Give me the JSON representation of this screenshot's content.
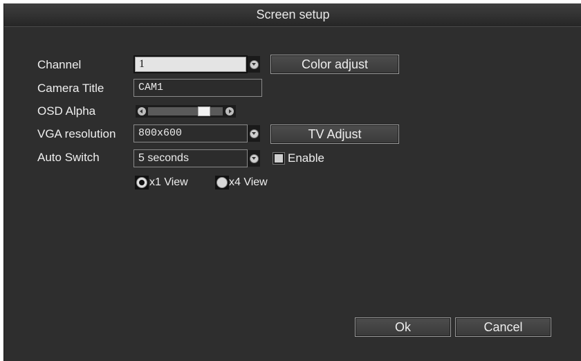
{
  "window": {
    "title": "Screen setup"
  },
  "form": {
    "channel": {
      "label": "Channel",
      "value": "1"
    },
    "camera_title": {
      "label": "Camera Title",
      "value": "CAM1"
    },
    "osd_alpha": {
      "label": "OSD Alpha",
      "level_fraction": 0.8
    },
    "vga_resolution": {
      "label": "VGA resolution",
      "value": "800x600"
    },
    "auto_switch": {
      "label": "Auto Switch",
      "value": "5 seconds",
      "enable_label": "Enable",
      "enabled": false
    },
    "view_mode": {
      "options": [
        {
          "label": "x1 View",
          "selected": true
        },
        {
          "label": "x4 View",
          "selected": false
        }
      ]
    }
  },
  "buttons": {
    "color_adjust": "Color adjust",
    "tv_adjust": "TV Adjust",
    "ok": "Ok",
    "cancel": "Cancel"
  },
  "icons": {
    "dropdown": "chevron-down-icon",
    "slider_left": "arrow-left-icon",
    "slider_right": "arrow-right-icon"
  },
  "colors": {
    "background": "#2e2e2e",
    "text": "#efefef",
    "active_field": "#e4e4e4"
  }
}
